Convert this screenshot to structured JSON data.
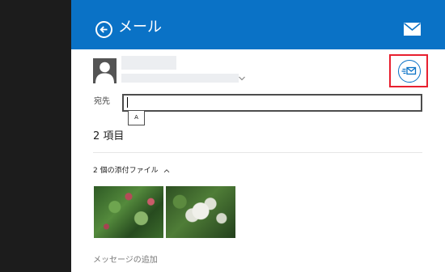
{
  "header": {
    "title": "メール",
    "back_icon": "back-arrow-icon",
    "mail_icon": "mail-icon",
    "background_color": "#0a72c6"
  },
  "from": {
    "avatar_icon": "person-icon",
    "name": "",
    "address": ""
  },
  "send": {
    "icon": "send-mail-icon",
    "highlight_color": "#e8202f"
  },
  "to_field": {
    "label": "宛先",
    "value": "",
    "ime_indicator": "A"
  },
  "items": {
    "count_label": "2 項目"
  },
  "attachments": {
    "toggle_label": "2 個の添付ファイル",
    "images": [
      {
        "alt": ""
      },
      {
        "alt": ""
      }
    ]
  },
  "message": {
    "placeholder": "メッセージの追加"
  }
}
